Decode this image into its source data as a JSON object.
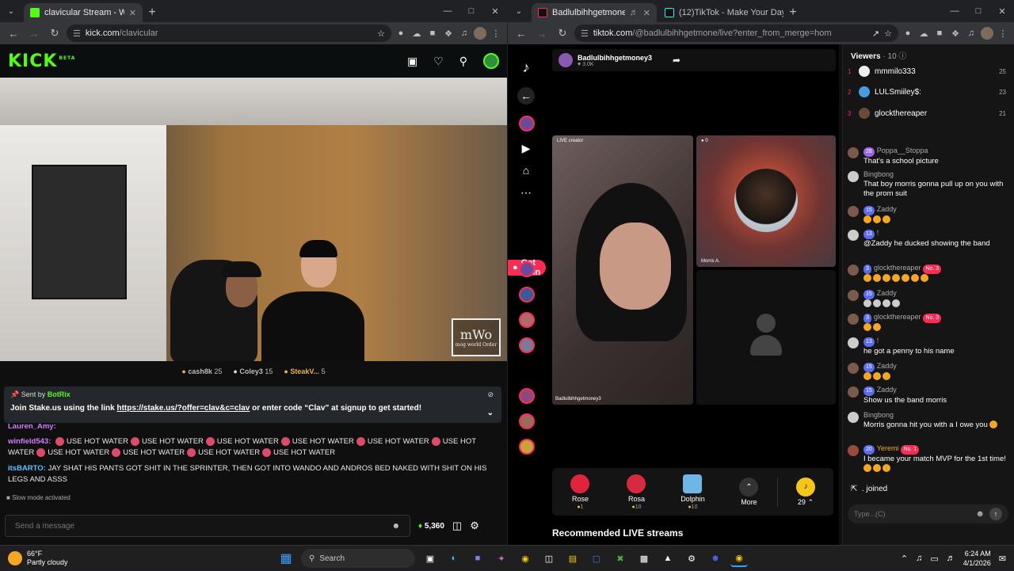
{
  "left_browser": {
    "tab_title": "clavicular Stream - Watch Live o",
    "url": "kick.com/clavicular",
    "url_host": "kick.com",
    "url_path": "/clavicular"
  },
  "kick": {
    "logo": "KICK",
    "logo_badge": "BETA",
    "watermark_big": "mWo",
    "watermark_small": "mog world Order",
    "tips": [
      {
        "name": "cash8k",
        "amount": "25"
      },
      {
        "name": "Coley3",
        "amount": "15"
      },
      {
        "name": "SteakV...",
        "amount": "5"
      }
    ],
    "pinned_prefix": "Sent by",
    "pinned_bot": "BotRix",
    "pinned_msg_before": "Join Stake.us using the link",
    "pinned_link": "https://stake.us/?offer=clav&c=clav",
    "pinned_msg_after": "or enter code “Clav” at signup to get started!",
    "chat_prev_user": "Lauren_Amy:",
    "chat_user1": "winfield543:",
    "chat_msg1": "USE HOT WATER",
    "chat_user2": "itsBARTO:",
    "chat_msg2": "JAY SHAT HIS PANTS GOT SHIT IN THE SPRINTER, THEN GOT INTO WANDO AND ANDROS BED NAKED WITH SHIT ON HIS LEGS AND ASSS",
    "slow_mode": "Slow mode activated",
    "send_placeholder": "Send a message",
    "points": "5,360"
  },
  "right_browser": {
    "tab1_title": "Badlulbihhgetmoney3 (@b",
    "tab2_title": "(12)TikTok - Make Your Day",
    "url_host": "tiktok.com",
    "url_path": "/@badlulbihhgetmone/live?enter_from_merge=homepage..."
  },
  "tiktok": {
    "host_name": "Badlulbihhgetmoney3",
    "host_likes": "3.0K",
    "get_coins": "Get Coin",
    "stage_label": "LIVE creator",
    "stage_name": "Badlulbihhgetmoney3",
    "guest_count": "0",
    "guest_name": "Morris A.",
    "gifts": [
      {
        "name": "Rose",
        "price": "1",
        "color": "#e0243c"
      },
      {
        "name": "Rosa",
        "price": "10",
        "color": "#d82a3e"
      },
      {
        "name": "Dolphin",
        "price": "10",
        "color": "#6fb6e8"
      }
    ],
    "more_label": "More",
    "coins": "29",
    "recommended": "Recommended LIVE streams",
    "viewers_label": "Viewers",
    "viewers_count": "10",
    "top_viewers": [
      {
        "rank": "1",
        "name": "mmmilo333",
        "score": "25"
      },
      {
        "rank": "2",
        "name": "LULSmiiley$:",
        "score": "23"
      },
      {
        "rank": "3",
        "name": "glockthereaper",
        "score": "21"
      }
    ],
    "comments": [
      {
        "lvl": "28",
        "user": "Poppa__Stoppa",
        "text": "That's a school picture"
      },
      {
        "lvl": "",
        "user": "Bingbong",
        "text": "That boy morris gonna pull up on you with the prom suit"
      },
      {
        "lvl": "15",
        "user": "Zaddy",
        "text": ""
      },
      {
        "lvl": "13",
        "user": "!",
        "text": "@Zaddy he ducked showing the band"
      },
      {
        "lvl": "3",
        "user": "glockthereaper",
        "badge": "No. 3",
        "text": ""
      },
      {
        "lvl": "15",
        "user": "Zaddy",
        "text": ""
      },
      {
        "lvl": "3",
        "user": "glockthereaper",
        "badge": "No. 3",
        "text": ""
      },
      {
        "lvl": "13",
        "user": "!",
        "text": "he got a penny to his name"
      },
      {
        "lvl": "15",
        "user": "Zaddy",
        "text": ""
      },
      {
        "lvl": "15",
        "user": "Zaddy",
        "text": "Show us the band morris"
      },
      {
        "lvl": "",
        "user": "Bingbong",
        "text": "Morris gonna hit you with a I owe you"
      },
      {
        "lvl": "20",
        "user": "Yeremi",
        "badge": "No. 1",
        "text": "I became your match MVP for the 1st time!"
      }
    ],
    "joined": "joined",
    "type_placeholder": "Type...(C)"
  },
  "taskbar": {
    "temp": "66°F",
    "weather": "Partly cloudy",
    "search": "Search",
    "time": "6:24 AM",
    "date": "4/1/2026"
  }
}
